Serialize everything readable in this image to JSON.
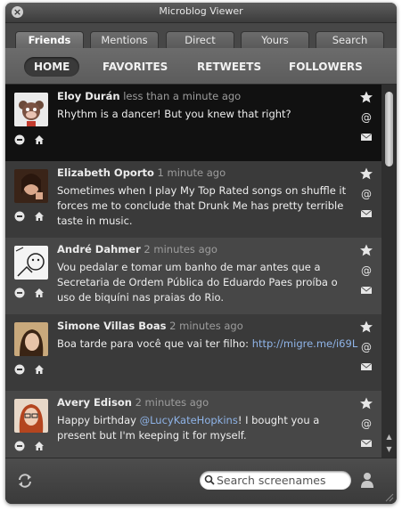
{
  "window": {
    "title": "Microblog Viewer"
  },
  "tabs": [
    "Friends",
    "Mentions",
    "Direct",
    "Yours",
    "Search"
  ],
  "subnav": [
    "HOME",
    "FAVORITES",
    "RETWEETS",
    "FOLLOWERS"
  ],
  "tweets": [
    {
      "name": "Eloy Durán",
      "time": "less than a minute ago",
      "text": "Rhythm is a dancer! But you knew that right?"
    },
    {
      "name": "Elizabeth Oporto",
      "time": "1 minute ago",
      "text": "Sometimes when I play My Top Rated songs on shuffle it forces me to conclude that Drunk Me has pretty terrible taste in music."
    },
    {
      "name": "André Dahmer",
      "time": "2 minutes ago",
      "text": "Vou pedalar e tomar um banho de mar antes que a Secretaria de Ordem Pública do Eduardo Paes proíba o uso de biquíni nas praias do Rio."
    },
    {
      "name": "Simone Villas Boas",
      "time": "2 minutes ago",
      "text_before": "Boa tarde para você que vai ter filho: ",
      "link": "http://migre.me/i69L"
    },
    {
      "name": "Avery Edison",
      "time": "2 minutes ago",
      "text_before": "Happy birthday ",
      "link": "@LucyKateHopkins",
      "text_after": "! I bought you a present but I'm keeping it for myself."
    }
  ],
  "search": {
    "placeholder": "Search screenames"
  },
  "icons": {
    "close": "close-icon",
    "star": "star-icon",
    "at": "at-icon",
    "mail": "mail-icon",
    "remove": "minus-circle-icon",
    "home": "home-icon",
    "refresh": "refresh-icon",
    "magnifier": "search-icon",
    "user": "user-icon"
  }
}
